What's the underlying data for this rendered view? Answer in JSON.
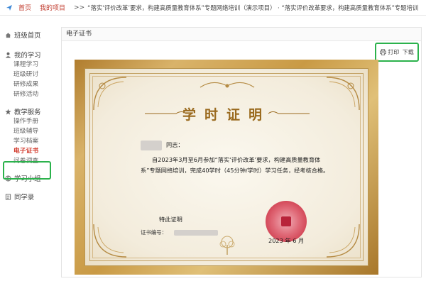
{
  "breadcrumb": {
    "home": "首页",
    "my_projects": "我的项目",
    "sep": ">>",
    "path": "“落实‘评价改革’要求，构建高质量教育体系”专题网络培训（演示项目） · “落实评价改革要求，构建高质量教育体系”专题培训"
  },
  "sidebar": {
    "class_home": "班级首页",
    "my_study": {
      "title": "我的学习",
      "items": [
        "课程学习",
        "班级研讨",
        "研修成果",
        "研修活动"
      ]
    },
    "teaching": {
      "title": "教学服务",
      "items": [
        "操作手册",
        "班级辅导",
        "学习档案",
        "电子证书",
        "问卷调查"
      ]
    },
    "study_group": "学习小组",
    "classmates": "同学录"
  },
  "panel": {
    "title": "电子证书"
  },
  "toolbar": {
    "print_label": "打印",
    "download_label": "下载"
  },
  "certificate": {
    "title": "学时证明",
    "salutation": "同志：",
    "body": "自2023年3月至6月参加“落实‘评价改革’要求，构建高质量教育体系”专题网络培训，完成40学时（45分钟/学时）学习任务，经考核合格。",
    "closing": "特此证明",
    "cert_no_label": "证书编号：",
    "date": "2023 年 6   月"
  },
  "colors": {
    "accent_red": "#d23a2c",
    "highlight_green": "#2bb24c",
    "gold": "#b07d2e"
  }
}
